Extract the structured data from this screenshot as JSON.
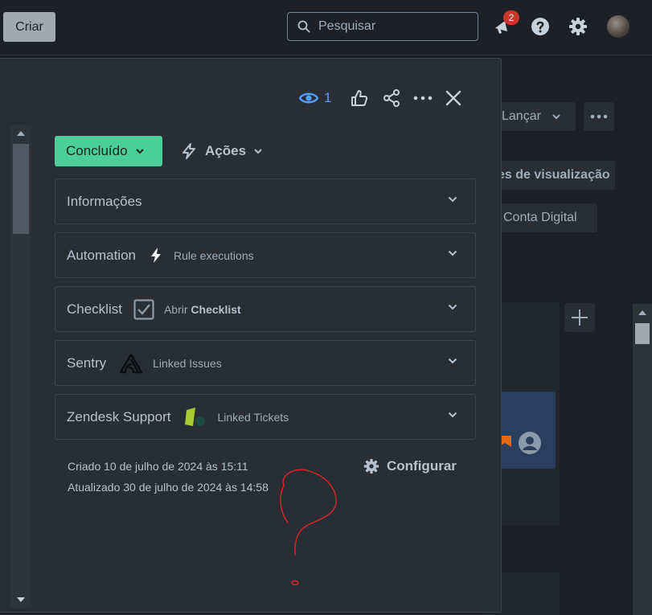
{
  "topbar": {
    "create_label": "Criar",
    "search_placeholder": "Pesquisar",
    "notifications_count": "2"
  },
  "board": {
    "launch_label": "Lançar",
    "view_label": "es de visualização",
    "filter_label": "l Conta Digital"
  },
  "issue": {
    "watchers_count": "1",
    "status_label": "Concluído",
    "actions_label": "Ações",
    "panels": [
      {
        "title": "Informações",
        "subtitle": ""
      },
      {
        "title": "Automation",
        "subtitle": "Rule executions"
      },
      {
        "title": "Checklist",
        "subtitle_prefix": "Abrir",
        "subtitle_bold": "Checklist"
      },
      {
        "title": "Sentry",
        "subtitle": "Linked Issues"
      },
      {
        "title": "Zendesk Support",
        "subtitle": "Linked Tickets"
      }
    ],
    "created": "Criado 10 de julho de 2024 às 15:11",
    "updated": "Atualizado 30 de julho de 2024 às 14:58",
    "configure_label": "Configurar"
  },
  "colors": {
    "background": "#1d2125",
    "modal": "#282e33",
    "status_green": "#4bce97",
    "accent_blue": "#579dff",
    "badge_red": "#c9372c",
    "annotation_red": "#e3242b"
  }
}
